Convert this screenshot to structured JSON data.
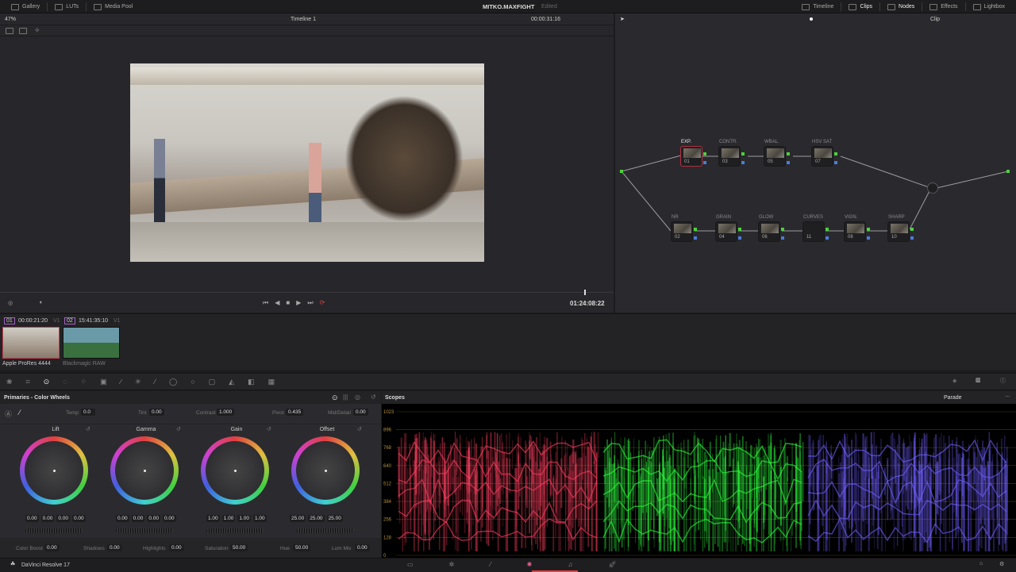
{
  "topbar": {
    "left": [
      {
        "label": "Gallery",
        "icon": "gallery-icon"
      },
      {
        "label": "LUTs",
        "icon": "luts-icon"
      },
      {
        "label": "Media Pool",
        "icon": "media-pool-icon"
      }
    ],
    "project": "MITKO.MAXFIGHT",
    "status": "Edited",
    "right": [
      {
        "label": "Timeline",
        "icon": "timeline-icon"
      },
      {
        "label": "Clips",
        "icon": "clips-icon"
      },
      {
        "label": "Nodes",
        "icon": "nodes-icon"
      },
      {
        "label": "Effects",
        "icon": "effects-icon"
      },
      {
        "label": "Lightbox",
        "icon": "lightbox-icon"
      }
    ]
  },
  "viewer": {
    "zoom": "47%",
    "timeline": "Timeline 1",
    "timecode": "00:00:31:16",
    "node_mode": "Clip",
    "playhead_tc": "01:24:08:22",
    "playhead_fraction": 0.95
  },
  "clips": [
    {
      "num": "01",
      "tc": "00:00:21:20",
      "track": "V1",
      "codec": "Apple ProRes 4444",
      "selected": true
    },
    {
      "num": "02",
      "tc": "15:41:35:10",
      "track": "V1",
      "codec": "Blackmagic RAW",
      "selected": false
    }
  ],
  "nodes": {
    "top": [
      {
        "label": "EXP.",
        "num": "01"
      },
      {
        "label": "CONTR.",
        "num": "03"
      },
      {
        "label": "WBAL.",
        "num": "05"
      },
      {
        "label": "HSV SAT",
        "num": "07"
      }
    ],
    "bottom": [
      {
        "label": "NR",
        "num": "02"
      },
      {
        "label": "GRAIN",
        "num": "04"
      },
      {
        "label": "GLOW",
        "num": "06"
      },
      {
        "label": "CURVES",
        "num": "11"
      },
      {
        "label": "VIGN.",
        "num": "08"
      },
      {
        "label": "SHARP",
        "num": "10"
      }
    ]
  },
  "primaries": {
    "title": "Primaries - Color Wheels",
    "temp_label": "Temp",
    "temp": "0.0",
    "tint_label": "Tint",
    "tint": "0.00",
    "contrast_label": "Contrast",
    "contrast": "1.000",
    "pivot_label": "Pivot",
    "pivot": "0.435",
    "middetail_label": "Mid/Detail",
    "middetail": "0.00",
    "wheels": [
      {
        "name": "Lift",
        "vals": [
          "0.00",
          "0.00",
          "0.00",
          "0.00"
        ]
      },
      {
        "name": "Gamma",
        "vals": [
          "0.00",
          "0.00",
          "0.00",
          "0.00"
        ]
      },
      {
        "name": "Gain",
        "vals": [
          "1.00",
          "1.00",
          "1.00",
          "1.00"
        ]
      },
      {
        "name": "Offset",
        "vals": [
          "25.00",
          "25.00",
          "25.00"
        ]
      }
    ],
    "colorboost_label": "Color Boost",
    "colorboost": "0.00",
    "shadows_label": "Shadows",
    "shadows": "0.00",
    "highlights_label": "Highlights",
    "highlights": "0.00",
    "saturation_label": "Saturation",
    "saturation": "50.00",
    "hue_label": "Hue",
    "hue": "50.00",
    "lummix_label": "Lum Mix",
    "lummix": "0.00"
  },
  "scopes": {
    "title": "Scopes",
    "mode": "Parade",
    "ticks": [
      "1023",
      "896",
      "768",
      "640",
      "512",
      "384",
      "256",
      "128",
      "0"
    ],
    "colors": [
      "#ff4060",
      "#30ff40",
      "#7060ff"
    ]
  },
  "app": "DaVinci Resolve 17"
}
